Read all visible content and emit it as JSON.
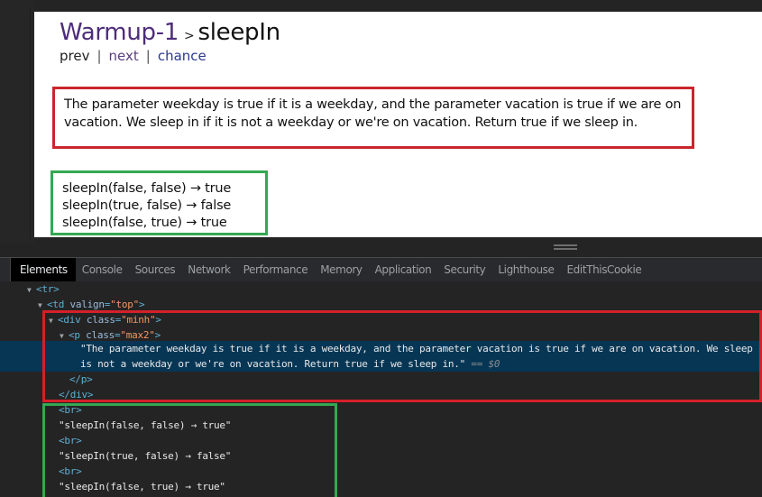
{
  "page": {
    "breadcrumb_parent": "Warmup-1",
    "breadcrumb_separator": ">",
    "title": "sleepIn",
    "nav": {
      "prev": "prev",
      "divider": "|",
      "next": "next",
      "chance": "chance"
    },
    "description": "The parameter weekday is true if it is a weekday, and the parameter vacation is true if we are on vacation. We sleep in if it is not a weekday or we're on vacation. Return true if we sleep in.",
    "examples": [
      "sleepIn(false, false) → true",
      "sleepIn(true, false) → false",
      "sleepIn(false, true) → true"
    ]
  },
  "devtools": {
    "tabs": [
      {
        "label": "Elements",
        "active": true
      },
      {
        "label": "Console",
        "active": false
      },
      {
        "label": "Sources",
        "active": false
      },
      {
        "label": "Network",
        "active": false
      },
      {
        "label": "Performance",
        "active": false
      },
      {
        "label": "Memory",
        "active": false
      },
      {
        "label": "Application",
        "active": false
      },
      {
        "label": "Security",
        "active": false
      },
      {
        "label": "Lighthouse",
        "active": false
      },
      {
        "label": "EditThisCookie",
        "active": false
      }
    ],
    "dom": {
      "tr_open": "<tr>",
      "td_tag": "<td ",
      "td_attr": "valign",
      "td_val": "\"top\"",
      "div_tag": "<div ",
      "div_attr": "class",
      "div_val": "\"minh\"",
      "p_tag": "<p ",
      "p_attr": "class",
      "p_val": "\"max2\"",
      "close_gt": ">",
      "eq": "=",
      "text_line1": "\"The parameter weekday is true if it is a weekday, and the parameter vacation is true if we are on vacation. We sleep in if it",
      "text_line2": "is not a weekday or we're on vacation. Return true if we sleep in.\"",
      "selected_marker": "== $0",
      "p_close": "</p>",
      "div_close": "</div>",
      "br": "<br>",
      "example_texts": [
        "\"sleepIn(false, false) → true\"",
        "\"sleepIn(true, false) → false\"",
        "\"sleepIn(false, true) → true\""
      ]
    }
  },
  "annotations": {
    "red": "#d4202a",
    "green": "#34a853"
  }
}
